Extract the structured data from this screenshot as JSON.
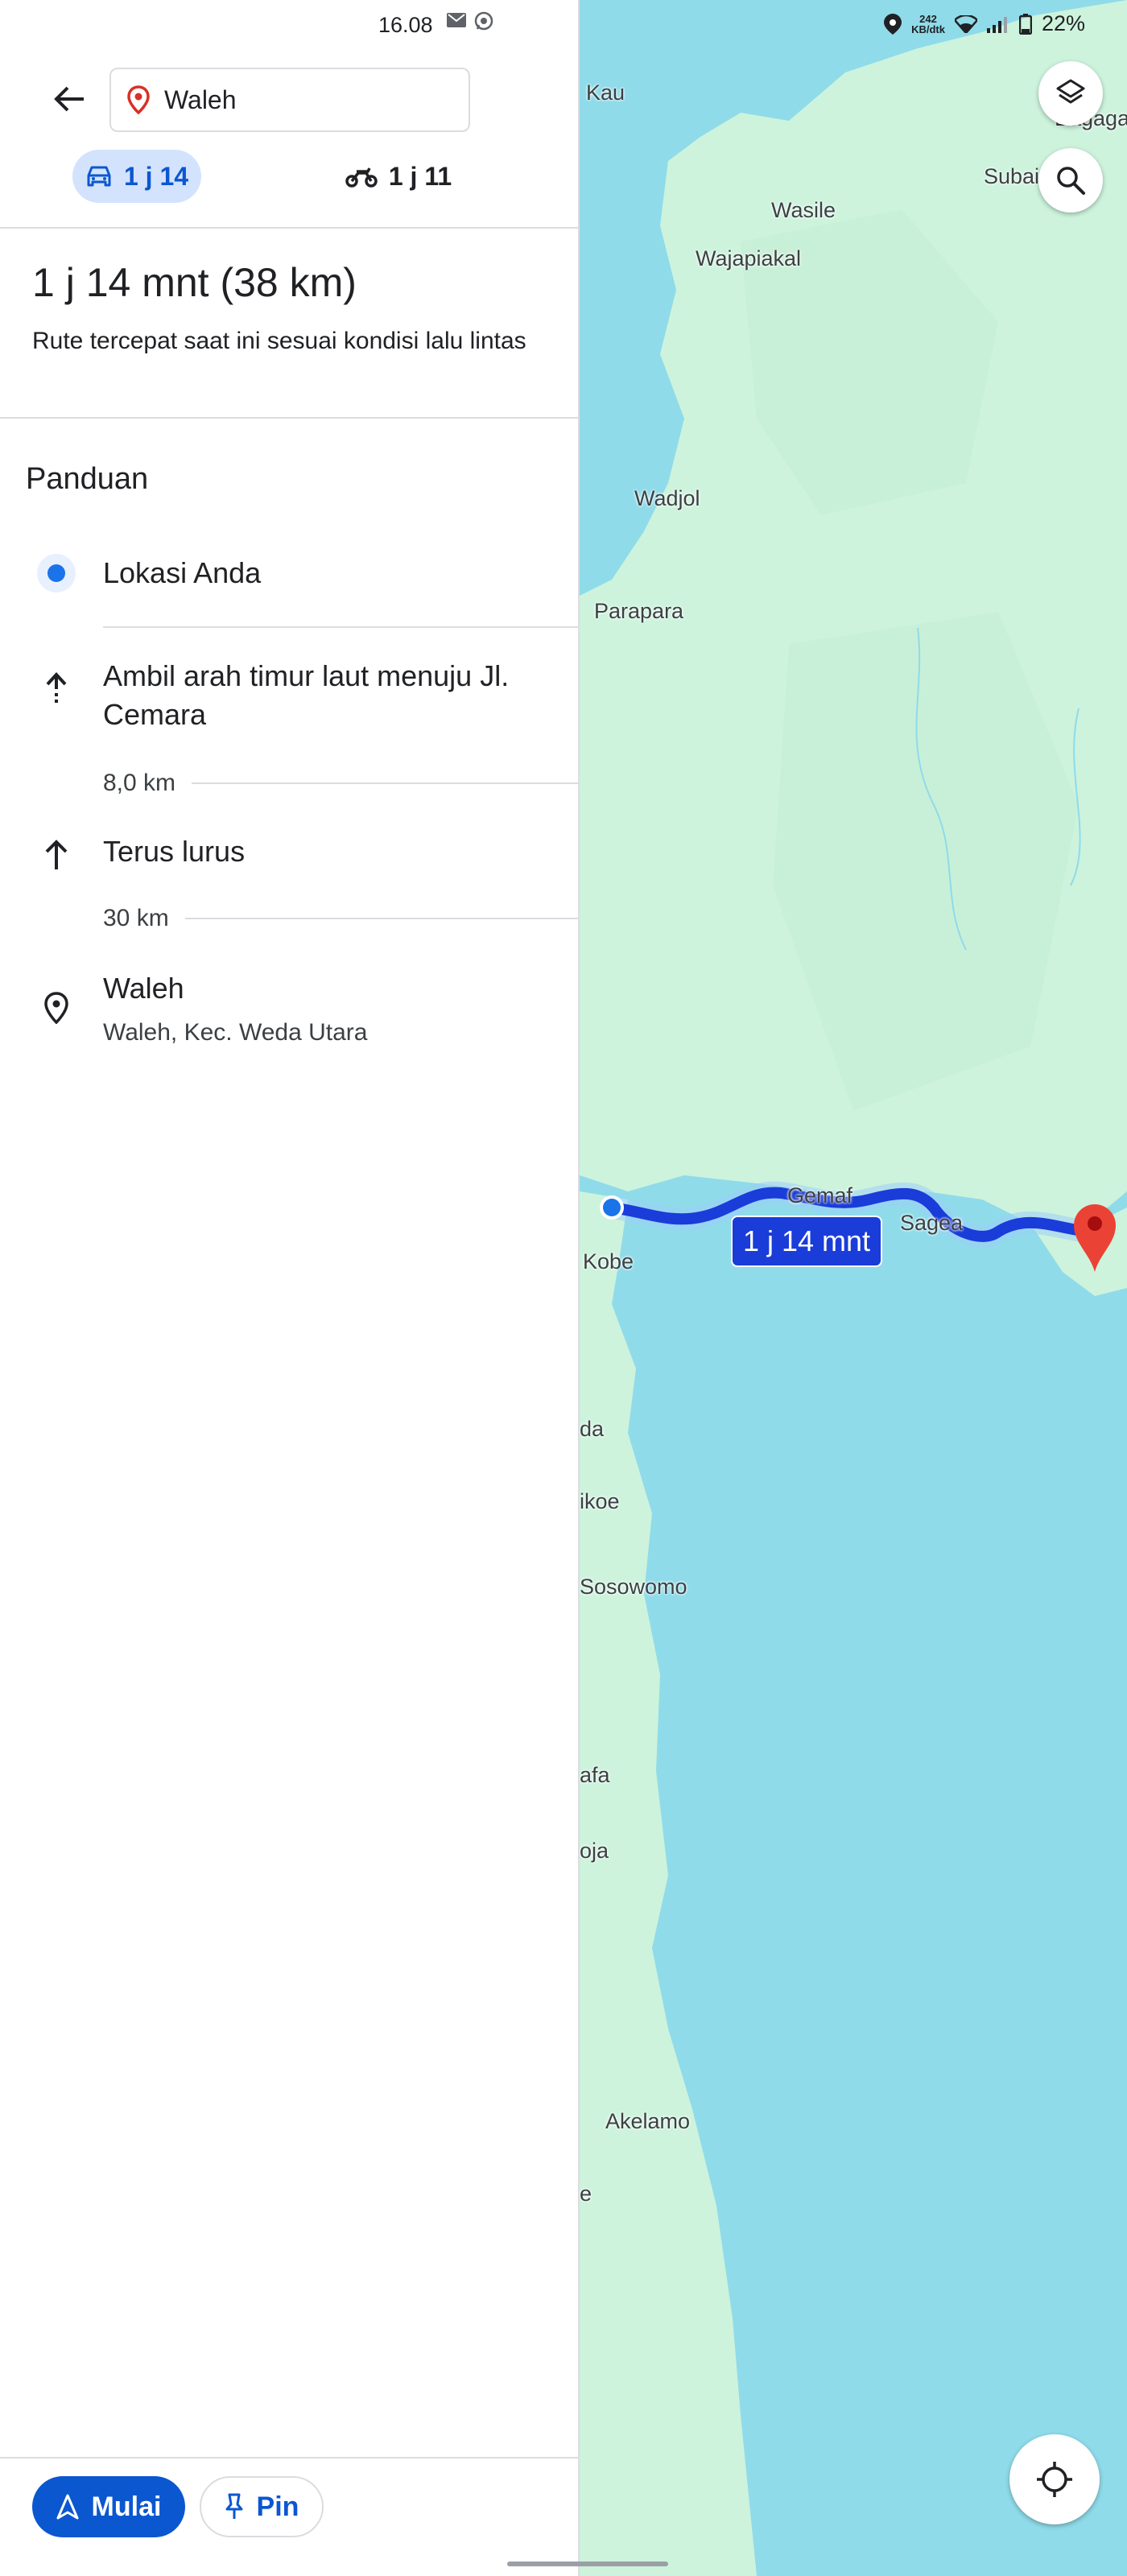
{
  "status_bar": {
    "time": "16.08",
    "net_speed": "242",
    "net_unit": "KB/dtk",
    "battery": "22%"
  },
  "search": {
    "value": "Waleh"
  },
  "modes": {
    "car_label": "1 j 14",
    "moto_label": "1 j 11"
  },
  "summary": {
    "title": "1 j 14 mnt (38 km)",
    "subtitle": "Rute tercepat saat ini sesuai kondisi lalu lintas"
  },
  "guide": {
    "heading": "Panduan",
    "origin": "Lokasi Anda",
    "steps": [
      {
        "text": "Ambil arah timur laut menuju Jl. Cemara",
        "distance": "8,0 km"
      },
      {
        "text": "Terus lurus",
        "distance": "30 km"
      }
    ],
    "destination": {
      "name": "Waleh",
      "address": "Waleh, Kec. Weda Utara"
    }
  },
  "actions": {
    "start_label": "Mulai",
    "pin_label": "Pin"
  },
  "map": {
    "route_badge": "1 j 14 mnt",
    "labels": {
      "kau": "Kau",
      "bagaga": "Bagaga",
      "subaim": "Subai",
      "wasile": "Wasile",
      "wajapiakal": "Wajapiakal",
      "wadjol": "Wadjol",
      "parapara": "Parapara",
      "gemaf": "Gemaf",
      "sagea": "Sagea",
      "kobe": "Kobe",
      "weda": "da",
      "fidikoe": "ikoe",
      "sosowomo": "Sosowomo",
      "lelilef": "afa",
      "kobe_oja": "oja",
      "akelamo": "Akelamo",
      "ee": "e"
    }
  },
  "colors": {
    "accent": "#0b57d0",
    "route": "#1a3cd9",
    "land": "#cdf3dd",
    "water": "#8fdbe9",
    "destination_pin": "#ea4335"
  }
}
